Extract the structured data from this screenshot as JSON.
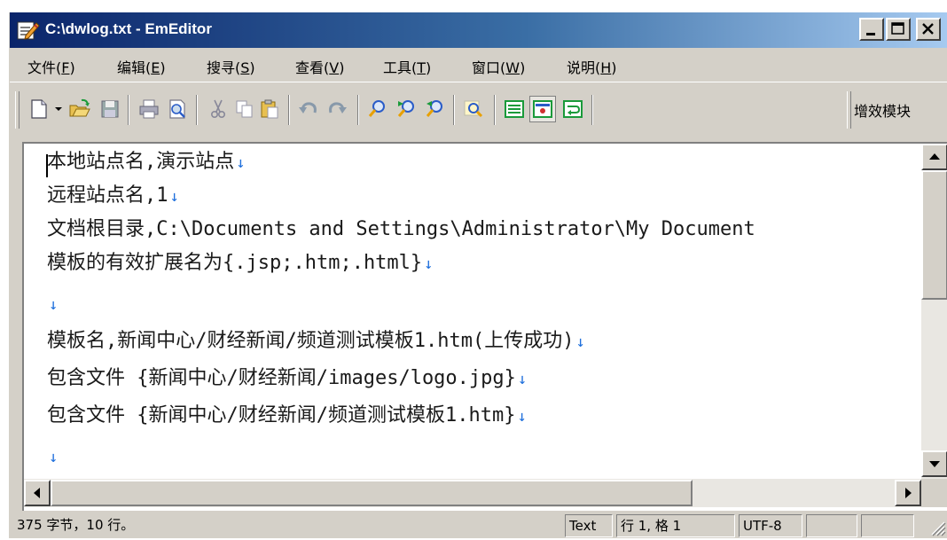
{
  "window": {
    "title": "C:\\dwlog.txt - EmEditor",
    "controls": {
      "minimize": "minimize-icon",
      "maximize": "maximize-icon",
      "close": "close-icon"
    }
  },
  "menu": [
    {
      "label": "文件(",
      "accel": "F",
      "close": ")"
    },
    {
      "label": "编辑(",
      "accel": "E",
      "close": ")"
    },
    {
      "label": "搜寻(",
      "accel": "S",
      "close": ")"
    },
    {
      "label": "查看(",
      "accel": "V",
      "close": ")"
    },
    {
      "label": "工具(",
      "accel": "T",
      "close": ")"
    },
    {
      "label": "窗口(",
      "accel": "W",
      "close": ")"
    },
    {
      "label": "说明(",
      "accel": "H",
      "close": ")"
    }
  ],
  "toolbar": {
    "plugins_label": "增效模块",
    "icons": [
      "new-file-icon",
      "dropdown-arrow-icon",
      "open-folder-icon",
      "save-icon",
      "print-icon",
      "print-preview-icon",
      "cut-icon",
      "copy-icon",
      "paste-icon",
      "undo-icon",
      "redo-icon",
      "find-icon",
      "find-next-icon",
      "find-previous-icon",
      "highlight-search-icon",
      "word-wrap-icon",
      "show-marks-icon",
      "toggle-wrap-icon"
    ],
    "accent_colors": {
      "green": "#1a9a3a",
      "blue": "#2a5cc8",
      "orange": "#e8a000"
    }
  },
  "editor": {
    "lines": [
      "本地站点名,演示站点",
      "远程站点名,1",
      "文档根目录,C:\\Documents and Settings\\Administrator\\My Document",
      "模板的有效扩展名为{.jsp;.htm;.html}",
      "",
      "模板名,新闻中心/财经新闻/频道测试模板1.htm(上传成功)",
      "包含文件 {新闻中心/财经新闻/images/logo.jpg}",
      "包含文件 {新闻中心/财经新闻/频道测试模板1.htm}",
      ""
    ],
    "eol_marker": "↓",
    "eol_shown": [
      true,
      true,
      false,
      true,
      true,
      true,
      true,
      true,
      true
    ],
    "eol_color": "#1e6fdc"
  },
  "status": {
    "info": "375 字节，10 行。",
    "mode": "Text",
    "position": "行 1, 格 1",
    "encoding": "UTF-8"
  }
}
